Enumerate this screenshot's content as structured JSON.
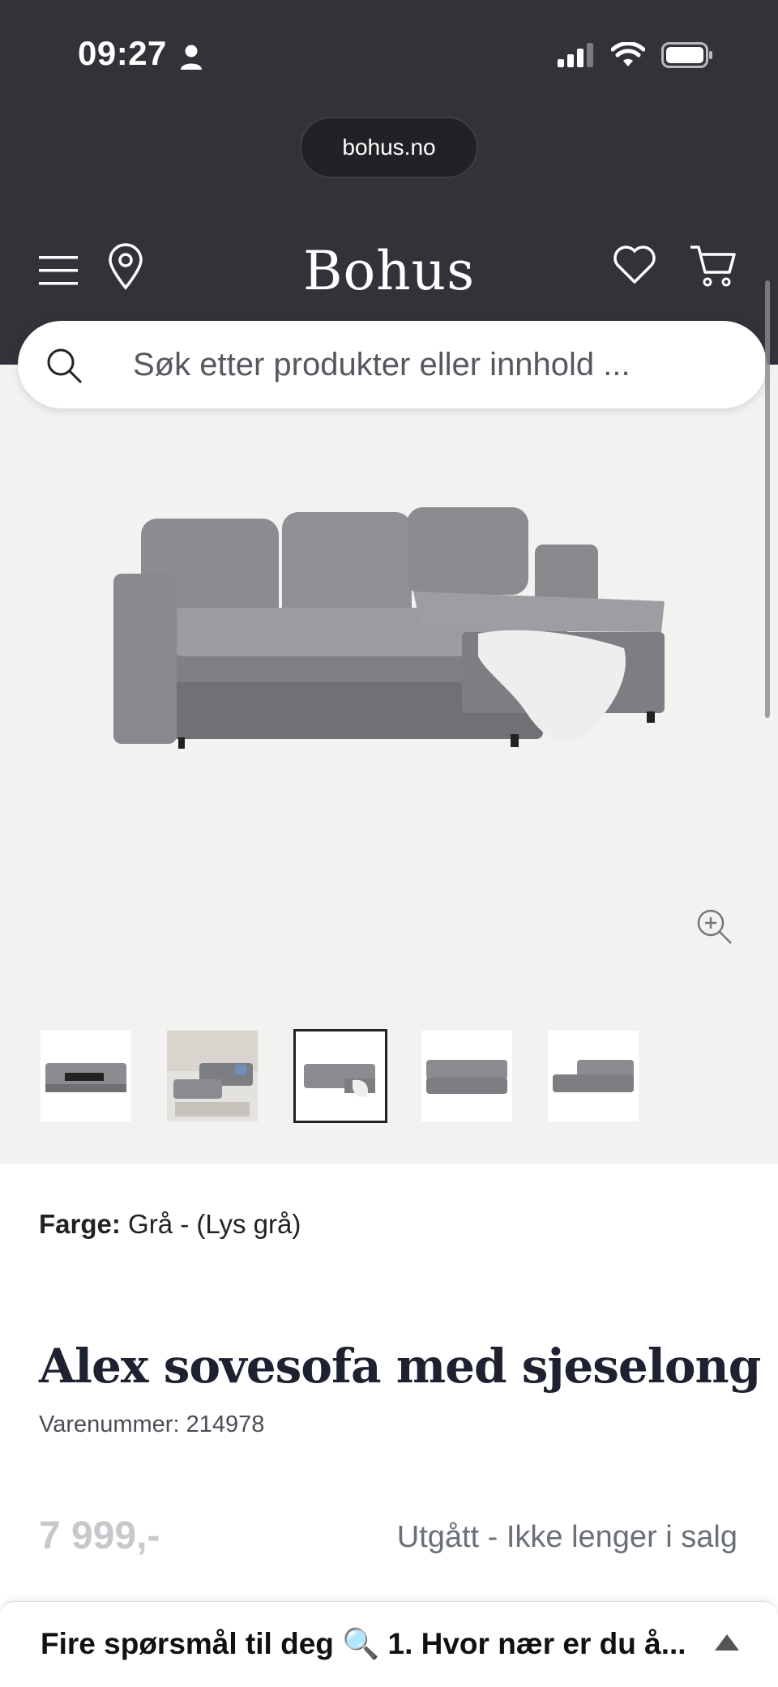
{
  "status_bar": {
    "time": "09:27"
  },
  "browser": {
    "url": "bohus.no"
  },
  "header": {
    "logo": "Bohus"
  },
  "search": {
    "placeholder": "Søk etter produkter eller innhold ..."
  },
  "gallery": {
    "thumbnails": [
      "thumbnail-1",
      "thumbnail-2",
      "thumbnail-3",
      "thumbnail-4",
      "thumbnail-5"
    ],
    "selected_index": 2
  },
  "product": {
    "color_label": "Farge:",
    "color_value": "Grå - (Lys grå)",
    "title": "Alex sovesofa med sjeselong",
    "sku": "Varenummer: 214978",
    "price": "7 999,-",
    "availability": "Utgått - Ikke lenger i salg"
  },
  "chat": {
    "prompt": "Fire spørsmål til deg 🔍 1. Hvor nær er du å..."
  },
  "colors": {
    "header_bg": "#323238",
    "gallery_bg": "#f3f2f0",
    "title_color": "#1d2130",
    "price_color": "#c6c8cc"
  },
  "icons": [
    "user-icon",
    "signal-icon",
    "wifi-icon",
    "battery-icon",
    "menu-icon",
    "location-pin-icon",
    "heart-icon",
    "cart-icon",
    "search-icon",
    "zoom-in-icon",
    "chevron-up-icon"
  ]
}
